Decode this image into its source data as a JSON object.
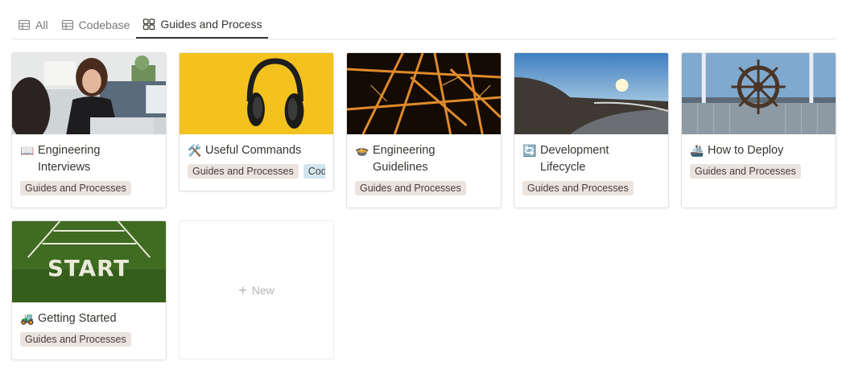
{
  "tabs": [
    {
      "label": "All",
      "icon": "table-icon",
      "active": false
    },
    {
      "label": "Codebase",
      "icon": "table-icon",
      "active": false
    },
    {
      "label": "Guides and Process",
      "icon": "gallery-icon",
      "active": true
    }
  ],
  "cards": [
    {
      "emoji": "📖",
      "title_line1": "Engineering",
      "title_line2": "Interviews",
      "tags": [
        "Guides and Processes"
      ],
      "cover": "people-talking"
    },
    {
      "emoji": "🛠️",
      "title_line1": "Useful Commands",
      "title_line2": "",
      "tags": [
        "Guides and Processes",
        "Codebase"
      ],
      "cover": "headphones-yellow"
    },
    {
      "emoji": "🍲",
      "title_line1": "Engineering",
      "title_line2": "Guidelines",
      "tags": [
        "Guides and Processes"
      ],
      "cover": "steel-structure"
    },
    {
      "emoji": "🔄",
      "title_line1": "Development",
      "title_line2": "Lifecycle",
      "tags": [
        "Guides and Processes"
      ],
      "cover": "road-sunset"
    },
    {
      "emoji": "🚢",
      "title_line1": "How to Deploy",
      "title_line2": "",
      "tags": [
        "Guides and Processes"
      ],
      "cover": "ship-wheel"
    },
    {
      "emoji": "🚜",
      "title_line1": "Getting Started",
      "title_line2": "",
      "tags": [
        "Guides and Processes"
      ],
      "cover": "start-track"
    }
  ],
  "new_card": {
    "label": "New"
  },
  "colors": {
    "tag_brown": "#ede3de",
    "tag_blue": "#d3e5ef",
    "text": "#37352f",
    "muted": "#787774"
  }
}
